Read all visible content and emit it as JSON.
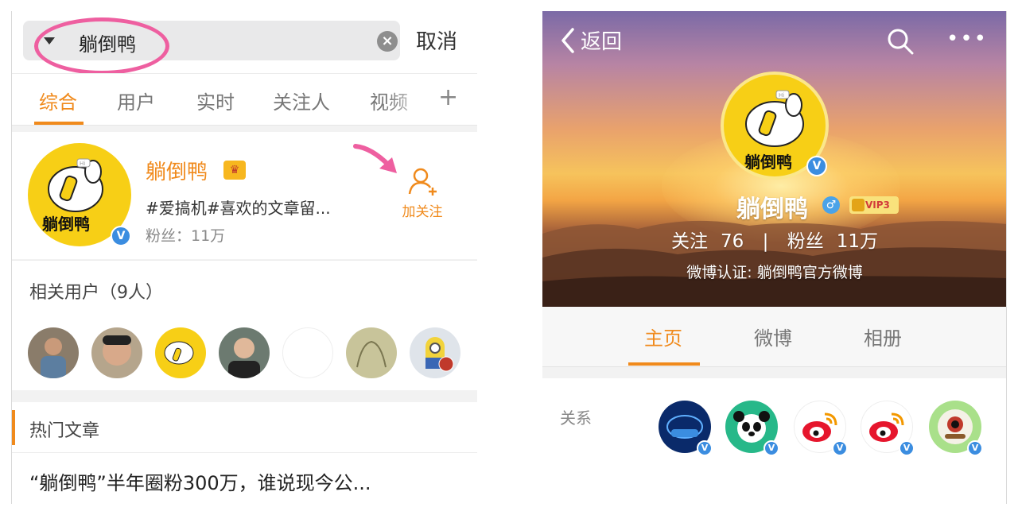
{
  "left": {
    "search": {
      "query": "躺倒鸭",
      "cancel_label": "取消"
    },
    "tabs": [
      {
        "label": "综合",
        "active": true
      },
      {
        "label": "用户",
        "active": false
      },
      {
        "label": "实时",
        "active": false
      },
      {
        "label": "关注人",
        "active": false
      },
      {
        "label": "视频",
        "active": false
      }
    ],
    "tab_more_label": "+",
    "user": {
      "name": "躺倒鸭",
      "avatar_text": "躺倒鸭",
      "bio": "#爱搞机#喜欢的文章留...",
      "fans": "粉丝：11万",
      "follow_label": "加关注"
    },
    "related": {
      "title": "相关用户（9人）"
    },
    "hot": {
      "title": "热门文章",
      "article": "“躺倒鸭”半年圈粉300万，谁说现今公..."
    }
  },
  "right": {
    "header": {
      "back_label": "返回",
      "more_label": "•••"
    },
    "profile": {
      "avatar_text": "躺倒鸭",
      "name": "躺倒鸭",
      "vip_label": "VIP3",
      "following_label": "关注",
      "following_count": "76",
      "separator": "|",
      "fans_label": "粉丝",
      "fans_count": "11万",
      "verification": "微博认证: 躺倒鸭官方微博"
    },
    "tabs": [
      {
        "label": "主页",
        "active": true
      },
      {
        "label": "微博",
        "active": false
      },
      {
        "label": "相册",
        "active": false
      }
    ],
    "relation": {
      "label": "关系"
    }
  },
  "colors": {
    "accent": "#f08a1c",
    "verify_blue": "#3b8de0",
    "highlight_pink": "#ee5fa0",
    "avatar_yellow": "#f7cf16"
  }
}
